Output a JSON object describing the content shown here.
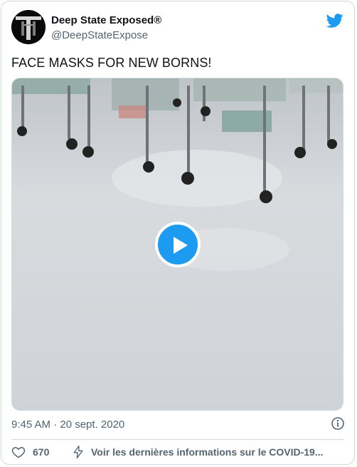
{
  "tweet": {
    "author_name": "Deep State Exposed®",
    "author_handle": "@DeepStateExpose",
    "text": "FACE MASKS FOR NEW BORNS!",
    "timestamp": "9:45 AM · 20 sept. 2020",
    "like_count": "670",
    "info_link": "Voir les dernières informations sur le COVID-19..."
  },
  "icons": {
    "brand": "twitter-bird-icon",
    "like": "heart-icon",
    "topic": "lightning-bolt-icon",
    "info": "info-icon",
    "play": "play-icon"
  },
  "colors": {
    "accent": "#1d9bf0",
    "text_primary": "#0f1419",
    "text_secondary": "#536471",
    "border": "#cfd9de"
  }
}
